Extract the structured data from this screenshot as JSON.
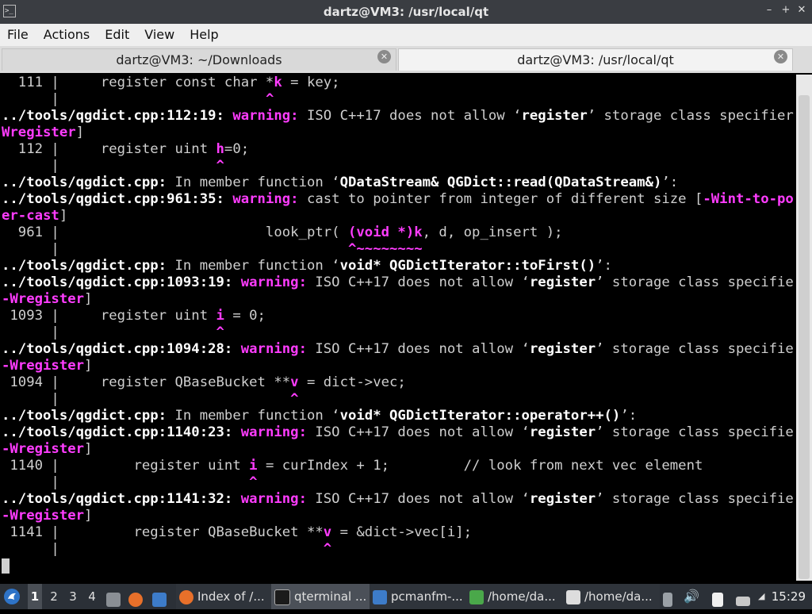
{
  "window": {
    "title": "dartz@VM3: /usr/local/qt",
    "buttons": {
      "minimize": "–",
      "maximize": "+",
      "close": "✕"
    }
  },
  "menu": [
    "File",
    "Actions",
    "Edit",
    "View",
    "Help"
  ],
  "tabs": [
    {
      "label": "dartz@VM3: ~/Downloads",
      "active": false
    },
    {
      "label": "dartz@VM3: /usr/local/qt",
      "active": true
    }
  ],
  "terminal": {
    "lines": [
      [
        {
          "t": "  111 |     register const char *"
        },
        {
          "t": "k",
          "c": "m"
        },
        {
          "t": " = key;"
        }
      ],
      [
        {
          "t": "      |                         "
        },
        {
          "t": "^",
          "c": "m"
        }
      ],
      [
        {
          "t": "../tools/qgdict.cpp:112:19: ",
          "c": "b"
        },
        {
          "t": "warning: ",
          "c": "m"
        },
        {
          "t": "ISO C++17 does not allow ‘"
        },
        {
          "t": "register",
          "c": "b"
        },
        {
          "t": "’ storage class specifier ["
        },
        {
          "t": "-",
          "c": "m"
        }
      ],
      [
        {
          "t": "Wregister",
          "c": "m"
        },
        {
          "t": "]"
        }
      ],
      [
        {
          "t": "  112 |     register uint "
        },
        {
          "t": "h",
          "c": "m"
        },
        {
          "t": "=0;"
        }
      ],
      [
        {
          "t": "      |                   "
        },
        {
          "t": "^",
          "c": "m"
        }
      ],
      [
        {
          "t": "../tools/qgdict.cpp: ",
          "c": "b"
        },
        {
          "t": "In member function ‘"
        },
        {
          "t": "QDataStream& QGDict::read(QDataStream&)",
          "c": "b"
        },
        {
          "t": "’:"
        }
      ],
      [
        {
          "t": "../tools/qgdict.cpp:961:35: ",
          "c": "b"
        },
        {
          "t": "warning: ",
          "c": "m"
        },
        {
          "t": "cast to pointer from integer of different size ["
        },
        {
          "t": "-Wint-to-point",
          "c": "m"
        }
      ],
      [
        {
          "t": "er-cast",
          "c": "m"
        },
        {
          "t": "]"
        }
      ],
      [
        {
          "t": "  961 |                         look_ptr( "
        },
        {
          "t": "(void *)k",
          "c": "m"
        },
        {
          "t": ", d, op_insert );"
        }
      ],
      [
        {
          "t": "      |                                   "
        },
        {
          "t": "^~~~~~~~~",
          "c": "m"
        }
      ],
      [
        {
          "t": "../tools/qgdict.cpp: ",
          "c": "b"
        },
        {
          "t": "In member function ‘"
        },
        {
          "t": "void* QGDictIterator::toFirst()",
          "c": "b"
        },
        {
          "t": "’:"
        }
      ],
      [
        {
          "t": "../tools/qgdict.cpp:1093:19: ",
          "c": "b"
        },
        {
          "t": "warning: ",
          "c": "m"
        },
        {
          "t": "ISO C++17 does not allow ‘"
        },
        {
          "t": "register",
          "c": "b"
        },
        {
          "t": "’ storage class specifier ["
        }
      ],
      [
        {
          "t": "-Wregister",
          "c": "m"
        },
        {
          "t": "]"
        }
      ],
      [
        {
          "t": " 1093 |     register uint "
        },
        {
          "t": "i",
          "c": "m"
        },
        {
          "t": " = 0;"
        }
      ],
      [
        {
          "t": "      |                   "
        },
        {
          "t": "^",
          "c": "m"
        }
      ],
      [
        {
          "t": "../tools/qgdict.cpp:1094:28: ",
          "c": "b"
        },
        {
          "t": "warning: ",
          "c": "m"
        },
        {
          "t": "ISO C++17 does not allow ‘"
        },
        {
          "t": "register",
          "c": "b"
        },
        {
          "t": "’ storage class specifier ["
        }
      ],
      [
        {
          "t": "-Wregister",
          "c": "m"
        },
        {
          "t": "]"
        }
      ],
      [
        {
          "t": " 1094 |     register QBaseBucket **"
        },
        {
          "t": "v",
          "c": "m"
        },
        {
          "t": " = dict->vec;"
        }
      ],
      [
        {
          "t": "      |                            "
        },
        {
          "t": "^",
          "c": "m"
        }
      ],
      [
        {
          "t": "../tools/qgdict.cpp: ",
          "c": "b"
        },
        {
          "t": "In member function ‘"
        },
        {
          "t": "void* QGDictIterator::operator++()",
          "c": "b"
        },
        {
          "t": "’:"
        }
      ],
      [
        {
          "t": "../tools/qgdict.cpp:1140:23: ",
          "c": "b"
        },
        {
          "t": "warning: ",
          "c": "m"
        },
        {
          "t": "ISO C++17 does not allow ‘"
        },
        {
          "t": "register",
          "c": "b"
        },
        {
          "t": "’ storage class specifier ["
        }
      ],
      [
        {
          "t": "-Wregister",
          "c": "m"
        },
        {
          "t": "]"
        }
      ],
      [
        {
          "t": " 1140 |         register uint "
        },
        {
          "t": "i",
          "c": "m"
        },
        {
          "t": " = curIndex + 1;         // look from next vec element"
        }
      ],
      [
        {
          "t": "      |                       "
        },
        {
          "t": "^",
          "c": "m"
        }
      ],
      [
        {
          "t": "../tools/qgdict.cpp:1141:32: ",
          "c": "b"
        },
        {
          "t": "warning: ",
          "c": "m"
        },
        {
          "t": "ISO C++17 does not allow ‘"
        },
        {
          "t": "register",
          "c": "b"
        },
        {
          "t": "’ storage class specifier ["
        }
      ],
      [
        {
          "t": "-Wregister",
          "c": "m"
        },
        {
          "t": "]"
        }
      ],
      [
        {
          "t": " 1141 |         register QBaseBucket **"
        },
        {
          "t": "v",
          "c": "m"
        },
        {
          "t": " = &dict->vec[i];"
        }
      ],
      [
        {
          "t": "      |                                "
        },
        {
          "t": "^",
          "c": "m"
        }
      ],
      []
    ]
  },
  "taskbar": {
    "desktops": [
      "1",
      "2",
      "3",
      "4"
    ],
    "tasks": [
      {
        "label": "Index of /...",
        "icon": "firefox-icon",
        "color": "#e8702a"
      },
      {
        "label": "qterminal ...",
        "icon": "terminal-icon",
        "color": "#1b1b1b"
      },
      {
        "label": "pcmanfm-...",
        "icon": "folder-icon",
        "color": "#3d7cc9"
      },
      {
        "label": "/home/da...",
        "icon": "text-editor-icon",
        "color": "#4aa84a"
      },
      {
        "label": "/home/da...",
        "icon": "pen-icon",
        "color": "#dddddd"
      }
    ],
    "clock": "15:29"
  }
}
